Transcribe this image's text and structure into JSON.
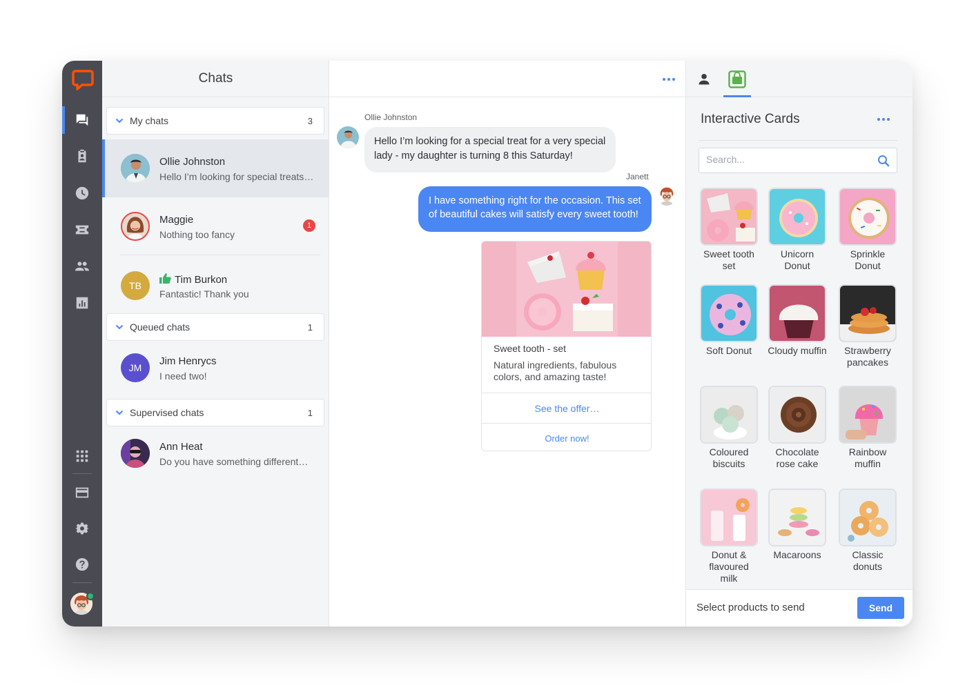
{
  "brand": {
    "accent": "#4b87f2",
    "logo_color": "#ff5100",
    "rail_bg": "#4a4a52"
  },
  "rail": {
    "items": [
      {
        "icon": "chats-icon"
      },
      {
        "icon": "customers-icon"
      },
      {
        "icon": "archives-icon"
      },
      {
        "icon": "tickets-icon"
      },
      {
        "icon": "agents-icon"
      },
      {
        "icon": "reports-icon"
      },
      {
        "icon": "apps-grid-icon"
      },
      {
        "icon": "billing-icon"
      },
      {
        "icon": "settings-icon"
      },
      {
        "icon": "help-icon"
      }
    ]
  },
  "chats": {
    "title": "Chats",
    "groups": [
      {
        "label": "My chats",
        "count": "3"
      },
      {
        "label": "Queued chats",
        "count": "1"
      },
      {
        "label": "Supervised chats",
        "count": "1"
      }
    ],
    "items": [
      {
        "name": "Ollie Johnston",
        "message": "Hello I’m looking for special treats …",
        "initials": ""
      },
      {
        "name": "Maggie",
        "message": "Nothing too fancy",
        "unread": "1",
        "initials": ""
      },
      {
        "name": "Tim Burkon",
        "message": "Fantastic! Thank you",
        "initials": "TB"
      },
      {
        "name": "Jim Henrycs",
        "message": "I need two!",
        "initials": "JM"
      },
      {
        "name": "Ann Heat",
        "message": "Do you have something different…",
        "initials": ""
      }
    ]
  },
  "conversation": {
    "visitor_name": "Ollie Johnston",
    "visitor_message": "Hello I’m looking for a special treat for a very special lady - my daughter is turning 8 this Saturday!",
    "agent_name": "Janett",
    "agent_message": "I have something right for the occasion. This set of beautiful cakes will satisfy every sweet tooth!",
    "card": {
      "title": "Sweet tooth - set",
      "description": "Natural ingredients, fabulous colors, and amazing taste!",
      "button_primary": "See the offer…",
      "button_secondary": "Order now!"
    }
  },
  "panel": {
    "title": "Interactive Cards",
    "search_placeholder": "Search...",
    "products": [
      {
        "label": "Sweet tooth set"
      },
      {
        "label": "Unicorn Donut"
      },
      {
        "label": "Sprinkle Donut"
      },
      {
        "label": "Soft Donut"
      },
      {
        "label": "Cloudy muffin"
      },
      {
        "label": "Strawberry pancakes"
      },
      {
        "label": "Coloured biscuits"
      },
      {
        "label": "Chocolate rose cake"
      },
      {
        "label": "Rainbow muffin"
      },
      {
        "label": "Donut & flavoured milk"
      },
      {
        "label": "Macaroons"
      },
      {
        "label": "Classic donuts"
      }
    ],
    "footer_text": "Select products to send",
    "send_label": "Send"
  }
}
